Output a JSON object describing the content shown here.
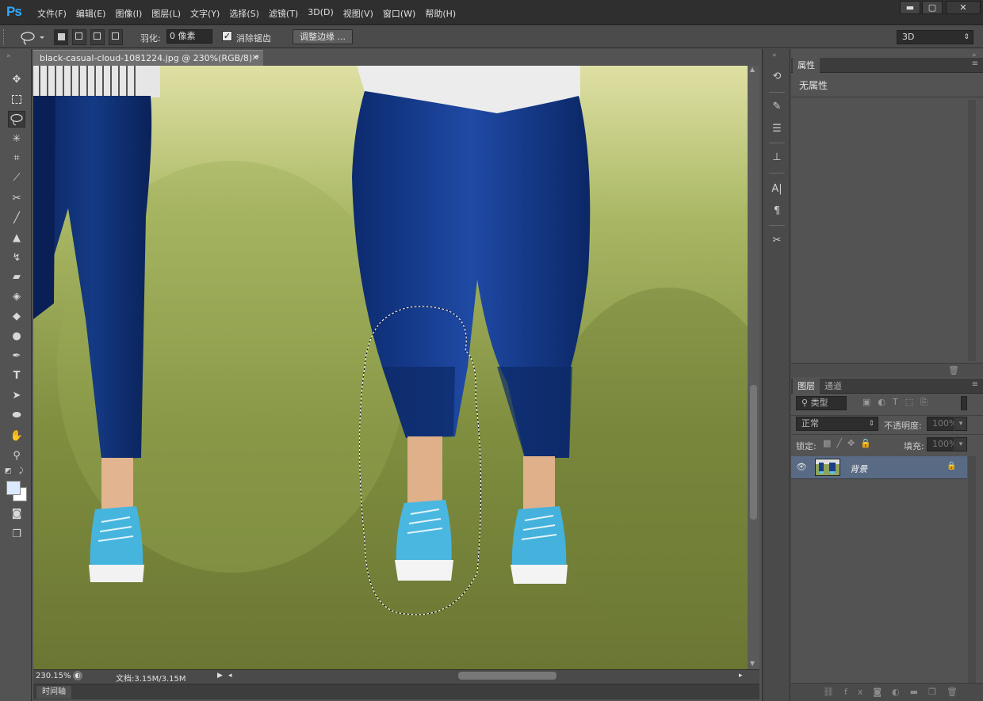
{
  "app": {
    "logo": "Ps"
  },
  "menu": [
    "文件(F)",
    "编辑(E)",
    "图像(I)",
    "图层(L)",
    "文字(Y)",
    "选择(S)",
    "滤镜(T)",
    "3D(D)",
    "视图(V)",
    "窗口(W)",
    "帮助(H)"
  ],
  "window_controls": {
    "minimize": "▬",
    "maximize": "▢",
    "close": "✕"
  },
  "options": {
    "feather_label": "羽化:",
    "feather_value": "0 像素",
    "antialias_label": "消除锯齿",
    "refine_button": "调整边缘 ...",
    "workspace": "3D"
  },
  "document": {
    "tab_title": "black-casual-cloud-1081224.jpg @ 230%(RGB/8) *",
    "zoom": "230.15%",
    "doc_info": "文档:3.15M/3.15M"
  },
  "timeline": {
    "tab": "时间轴"
  },
  "properties": {
    "tab": "属性",
    "content": "无属性"
  },
  "layers": {
    "tabs": [
      "图层",
      "通道"
    ],
    "filter_kind": "类型",
    "blend_mode": "正常",
    "opacity_label": "不透明度:",
    "opacity_value": "100%",
    "lock_label": "锁定:",
    "fill_label": "填充:",
    "fill_value": "100%",
    "items": [
      {
        "name": "背景",
        "visible": true,
        "locked": true
      }
    ]
  }
}
